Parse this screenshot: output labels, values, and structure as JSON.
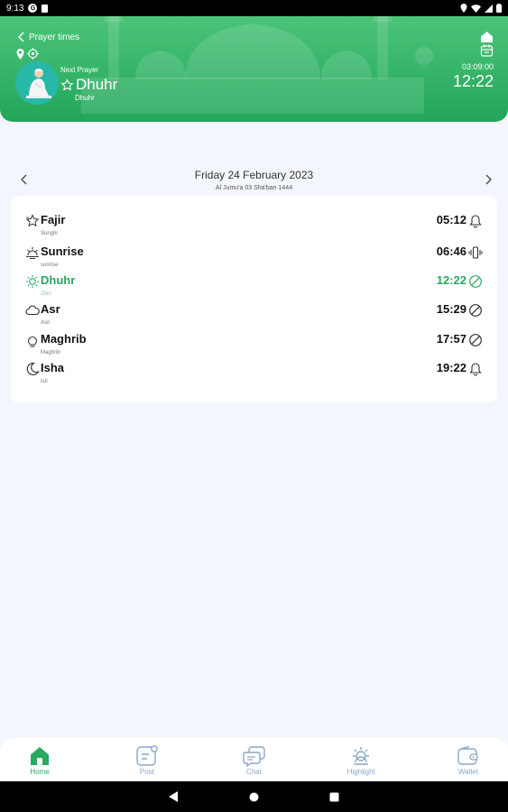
{
  "status_bar": {
    "time": "9:13"
  },
  "header": {
    "back_label": "Prayer times",
    "next_prayer_label": "Next Prayer",
    "next_prayer_name": "Dhuhr",
    "next_prayer_sub": "Dhuhr",
    "countdown": "03:09:00",
    "next_prayer_time": "12:22",
    "accent_color": "#2aa85e"
  },
  "date_nav": {
    "gregorian": "Friday 24 February 2023",
    "hijri": "Al Jumu'a 03 Sha'ban 1444"
  },
  "prayers": [
    {
      "name": "Fajir",
      "sub": "Sunghi",
      "time": "05:12",
      "icon": "star-outline-icon",
      "alert": "bell-icon"
    },
    {
      "name": "Sunrise",
      "sub": "sunrise",
      "time": "06:46",
      "icon": "sunrise-icon",
      "alert": "vibrate-icon"
    },
    {
      "name": "Dhuhr",
      "sub": "Zhiri",
      "time": "12:22",
      "icon": "sun-icon",
      "alert": "mute-icon",
      "active": true
    },
    {
      "name": "Asr",
      "sub": "Asri",
      "time": "15:29",
      "icon": "cloud-icon",
      "alert": "mute-icon"
    },
    {
      "name": "Maghrib",
      "sub": "Maghrib",
      "time": "17:57",
      "icon": "sunset-icon",
      "alert": "mute-icon"
    },
    {
      "name": "Isha",
      "sub": "Isti",
      "time": "19:22",
      "icon": "moon-icon",
      "alert": "bell-icon"
    }
  ],
  "tabs": [
    {
      "label": "Home",
      "icon": "home-icon",
      "active": true
    },
    {
      "label": "Post",
      "icon": "post-icon"
    },
    {
      "label": "Chat",
      "icon": "chat-icon"
    },
    {
      "label": "Highlight",
      "icon": "highlight-icon"
    },
    {
      "label": "Wallet",
      "icon": "wallet-icon"
    }
  ]
}
